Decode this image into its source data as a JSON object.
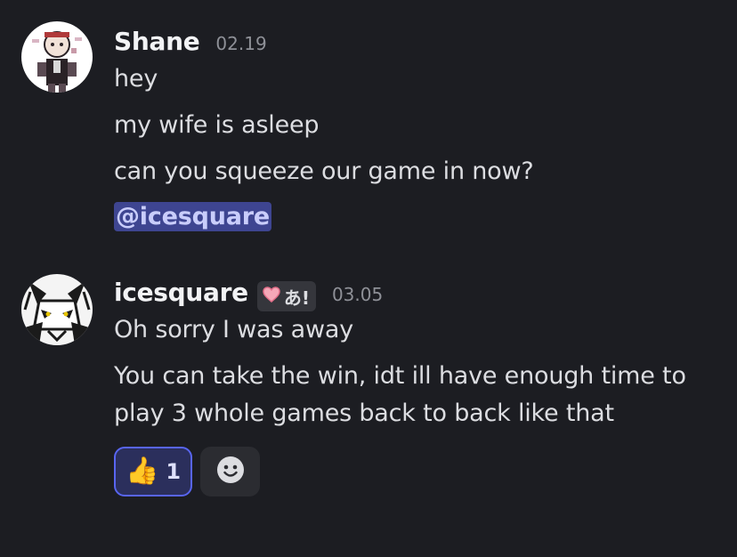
{
  "messages": [
    {
      "author": "Shane",
      "timestamp": "02.19",
      "lines": [
        "hey",
        "my wife is asleep",
        "can you squeeze our game in now?"
      ],
      "mention": "@icesquare"
    },
    {
      "author": "icesquare",
      "timestamp": "03.05",
      "tag": {
        "icon": "heart-icon",
        "text": "あ!"
      },
      "lines": [
        "Oh sorry I was away",
        "You can take the win, idt ill have enough time to",
        "play 3 whole games back to back like that"
      ],
      "reactions": [
        {
          "emoji": "👍",
          "icon": "thumbs-up-icon",
          "count": "1",
          "reacted": true
        }
      ],
      "add_reaction_icon": "smiley-face-icon"
    }
  ],
  "colors": {
    "background": "#1c1d22",
    "mention_bg": "#3e4591",
    "accent": "#5865f2"
  }
}
